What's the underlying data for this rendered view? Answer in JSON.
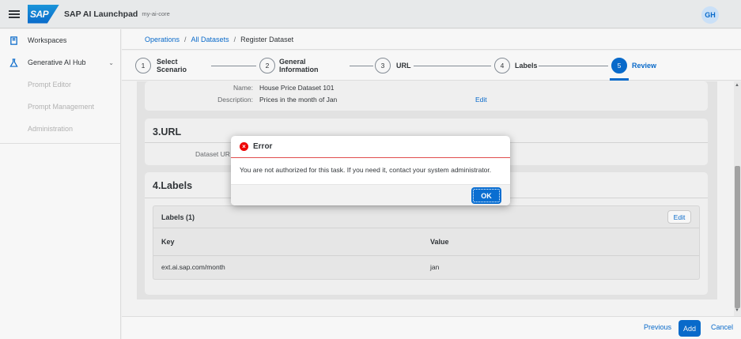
{
  "shell": {
    "logo": "SAP",
    "title": "SAP AI Launchpad",
    "subtitle": "my-ai-core",
    "avatar": "GH"
  },
  "sidebar": {
    "items": [
      {
        "label": "Workspaces",
        "icon": "workspaces-icon"
      },
      {
        "label": "Generative AI Hub",
        "icon": "flask-icon",
        "expanded": true
      }
    ],
    "subitems": [
      "Prompt Editor",
      "Prompt Management",
      "Administration"
    ]
  },
  "breadcrumb": {
    "items": [
      "Operations",
      "All Datasets"
    ],
    "current": "Register Dataset",
    "separator": "/"
  },
  "wizard": {
    "steps": [
      {
        "num": "1",
        "line1": "Select",
        "line2": "Scenario"
      },
      {
        "num": "2",
        "line1": "General",
        "line2": "Information"
      },
      {
        "num": "3",
        "line1": "URL",
        "line2": ""
      },
      {
        "num": "4",
        "line1": "Labels",
        "line2": ""
      },
      {
        "num": "5",
        "line1": "Review",
        "line2": ""
      }
    ],
    "active_step": 5
  },
  "general": {
    "name_label": "Name:",
    "name_value": "House Price Dataset 101",
    "desc_label": "Description:",
    "desc_value": "Prices in the month of Jan",
    "edit": "Edit"
  },
  "url_section": {
    "title": "3.URL",
    "label": "Dataset UR"
  },
  "labels_section": {
    "title": "4.Labels",
    "card_title": "Labels (1)",
    "edit": "Edit",
    "columns": [
      "Key",
      "Value"
    ],
    "rows": [
      {
        "key": "ext.ai.sap.com/month",
        "value": "jan"
      }
    ]
  },
  "footer": {
    "previous": "Previous",
    "add": "Add",
    "cancel": "Cancel"
  },
  "dialog": {
    "title": "Error",
    "message": "You are not authorized for this task. If you need it, contact your system administrator.",
    "ok": "OK"
  },
  "colors": {
    "brand": "#0a6ed1",
    "error": "#e00000"
  }
}
